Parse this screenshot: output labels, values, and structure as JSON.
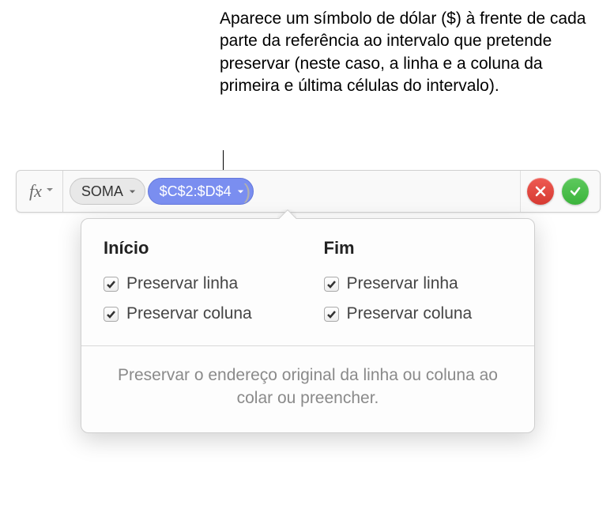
{
  "annotation": "Aparece um símbolo de dólar ($) à frente de cada parte da referência ao intervalo que pretende preservar (neste caso, a linha e a coluna da primeira e última células do intervalo).",
  "formula_bar": {
    "fx_label": "fx",
    "function_token": "SOMA",
    "reference_token": "$C$2:$D$4"
  },
  "popover": {
    "start": {
      "title": "Início",
      "preserve_row": "Preservar linha",
      "preserve_col": "Preservar coluna"
    },
    "end": {
      "title": "Fim",
      "preserve_row": "Preservar linha",
      "preserve_col": "Preservar coluna"
    },
    "footer": "Preservar o endereço original da linha ou coluna ao colar ou preencher."
  }
}
